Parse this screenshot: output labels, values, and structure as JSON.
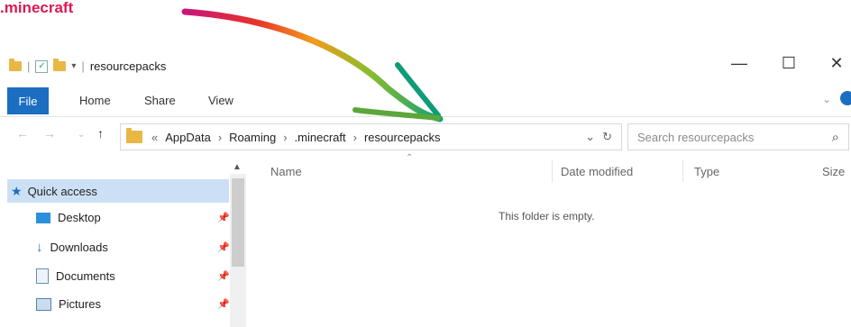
{
  "caption": ".minecraft",
  "titlebar": {
    "title": "resourcepacks",
    "minimize": "—",
    "maximize": "☐",
    "close": "✕"
  },
  "ribbon": {
    "tabs": [
      "File",
      "Home",
      "Share",
      "View"
    ]
  },
  "nav": {
    "back": "←",
    "forward": "→",
    "up": "↑"
  },
  "address": {
    "overflow": "«",
    "crumbs": [
      "AppData",
      "Roaming",
      ".minecraft",
      "resourcepacks"
    ],
    "separator": "›",
    "dropdown": "⌄",
    "refresh": "↻"
  },
  "search": {
    "placeholder": "Search resourcepacks",
    "icon": "⌕"
  },
  "columns": {
    "name": "Name",
    "date": "Date modified",
    "type": "Type",
    "size": "Size"
  },
  "empty_message": "This folder is empty.",
  "sidebar": {
    "quick_access": "Quick access",
    "items": [
      {
        "label": "Desktop",
        "icon": "desktop-icon"
      },
      {
        "label": "Downloads",
        "icon": "downloads-icon"
      },
      {
        "label": "Documents",
        "icon": "documents-icon"
      },
      {
        "label": "Pictures",
        "icon": "pictures-icon"
      }
    ]
  },
  "colors": {
    "file_tab": "#1b6ec2",
    "selected_row": "#cce0f5",
    "caption": "#d81a55"
  }
}
